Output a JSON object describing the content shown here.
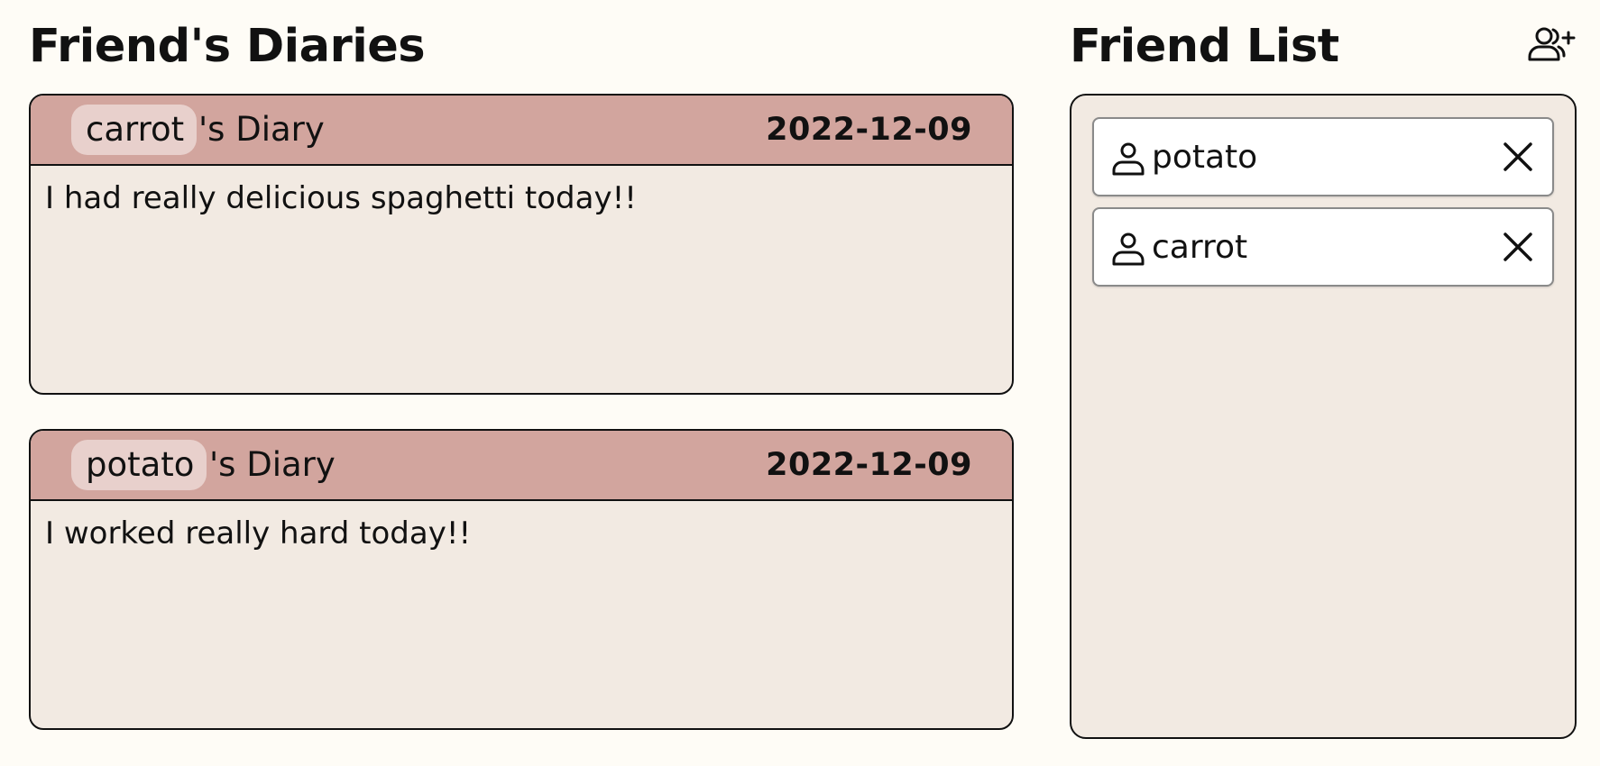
{
  "diaries_section": {
    "title": "Friend's Diaries",
    "diaries": [
      {
        "author": "carrot",
        "title_suffix": "'s Diary",
        "date": "2022-12-09",
        "content": "I had really delicious spaghetti today!!"
      },
      {
        "author": "potato",
        "title_suffix": "'s Diary",
        "date": "2022-12-09",
        "content": "I worked really hard today!!"
      }
    ]
  },
  "friends_section": {
    "title": "Friend List",
    "add_friend_icon": "user-plus-icon",
    "friends": [
      {
        "name": "potato",
        "icon": "user-icon",
        "remove_icon": "close-icon"
      },
      {
        "name": "carrot",
        "icon": "user-icon",
        "remove_icon": "close-icon"
      }
    ]
  },
  "colors": {
    "page_background": "#fefcf6",
    "card_background": "#f2eae2",
    "header_background": "#d2a59e",
    "author_pill": "#e8d0cc"
  }
}
